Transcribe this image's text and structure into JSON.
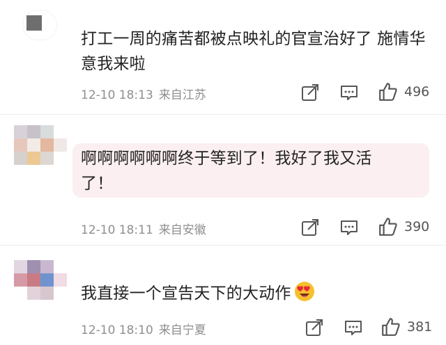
{
  "comments": [
    {
      "text": "打工一周的痛苦都被点映礼的官宣治好了 施情华意我来啦",
      "time": "12-10 18:13",
      "location": "来自江苏",
      "likes": "496",
      "highlighted": false
    },
    {
      "text": "啊啊啊啊啊啊终于等到了！我好了我又活了！",
      "time": "12-10 18:11",
      "location": "来自安徽",
      "likes": "390",
      "highlighted": true
    },
    {
      "text": "我直接一个宣告天下的大动作",
      "emoji": "heart-eyes-emoji",
      "time": "12-10 18:10",
      "location": "来自宁夏",
      "likes": "381",
      "highlighted": false
    }
  ],
  "colors": {
    "highlight_bg": "#fbeff1",
    "meta_text": "#8f8f8f",
    "body_text": "#222222",
    "emoji_face": "#f6c02c",
    "emoji_heart": "#e8263a"
  }
}
